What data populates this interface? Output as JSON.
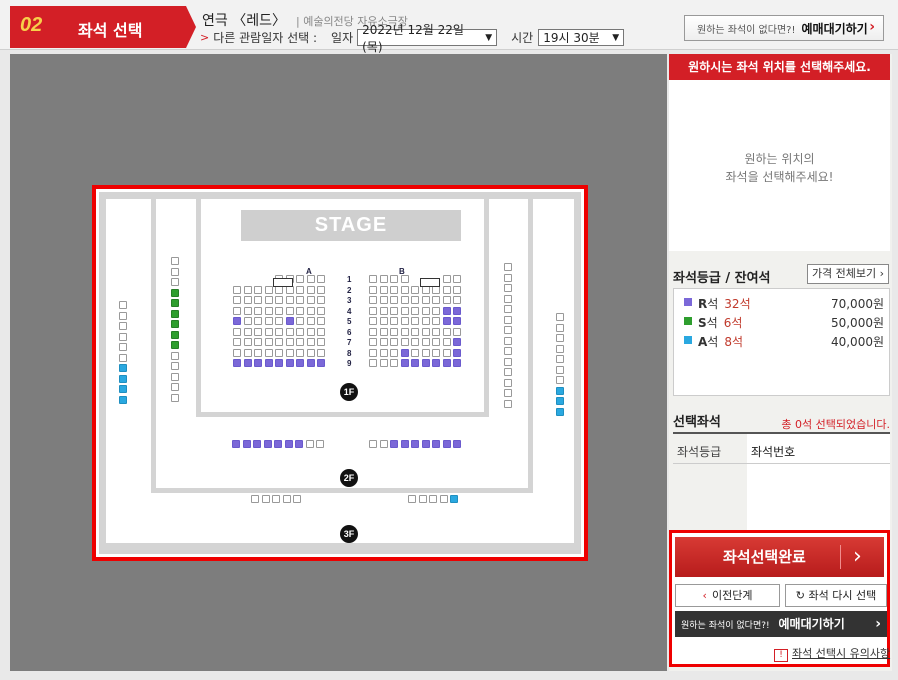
{
  "header": {
    "step_number": "02",
    "step_title": "좌석 선택",
    "show_title": "연극 〈레드〉",
    "venue": "| 예술의전당 자유소극장",
    "other_date_label": "다른 관람일자 선택 :",
    "date_label": "일자",
    "date_value": "2022년 12월 22일(목)",
    "time_label": "시간",
    "time_value": "19시 30분",
    "wait_hint": "원하는 좌석이 없다면?!",
    "wait_label": "예매대기하기"
  },
  "seatmap": {
    "stage_label": "STAGE",
    "floors": [
      "1F",
      "2F",
      "3F"
    ],
    "sections": [
      "A",
      "B"
    ],
    "rows": [
      "1",
      "2",
      "3",
      "4",
      "5",
      "6",
      "7",
      "8",
      "9"
    ]
  },
  "side": {
    "pick_banner": "원하시는 좌석 위치를 선택해주세요.",
    "pick_placeholder": "원하는 위치의\n좌석을 선택해주세요!",
    "grade_title": "좌석등급 / 잔여석",
    "price_button": "가격 전체보기",
    "grades": [
      {
        "grade": "R",
        "suffix": "석",
        "count": "32석",
        "price": "70,000원",
        "color": "#7b68d8"
      },
      {
        "grade": "S",
        "suffix": "석",
        "count": "6석",
        "price": "50,000원",
        "color": "#2e9e2e"
      },
      {
        "grade": "A",
        "suffix": "석",
        "count": "8석",
        "price": "40,000원",
        "color": "#2aa8e0"
      }
    ],
    "chosen_title": "선택좌석",
    "chosen_count": "총 0석 선택되었습니다.",
    "col_grade": "좌석등급",
    "col_number": "좌석번호",
    "complete_button": "좌석선택완료",
    "prev_button": "이전단계",
    "reset_button": "좌석 다시 선택",
    "wait_hint": "원하는 좌석이 없다면?!",
    "wait_label": "예매대기하기",
    "notice_link": "좌석 선택시 유의사항"
  },
  "colors": {
    "accent": "#d31f26",
    "R": "#7b68d8",
    "S": "#2e9e2e",
    "A": "#2aa8e0"
  }
}
